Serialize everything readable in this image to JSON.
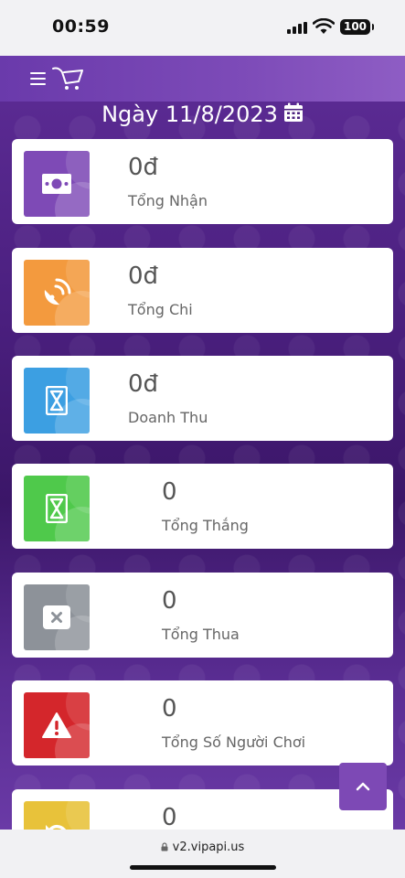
{
  "status_bar": {
    "time": "00:59",
    "battery": "100"
  },
  "header": {
    "menu_icon": "hamburger-icon",
    "logo_icon": "cart-icon"
  },
  "date_title": {
    "text": "Ngày 11/8/2023",
    "icon": "calendar-icon"
  },
  "stats": [
    {
      "value": "0đ",
      "label": "Tổng Nhận",
      "icon": "money-icon",
      "color": "#7e4ab6"
    },
    {
      "value": "0đ",
      "label": "Tổng Chi",
      "icon": "satellite-dish-icon",
      "color": "#f39a3e"
    },
    {
      "value": "0đ",
      "label": "Doanh Thu",
      "icon": "hourglass-icon",
      "color": "#3c9fe2"
    },
    {
      "value": "0",
      "label": "Tổng Thắng",
      "icon": "hourglass-icon",
      "color": "#4fc94b"
    },
    {
      "value": "0",
      "label": "Tổng Thua",
      "icon": "close-box-icon",
      "color": "#8d9299"
    },
    {
      "value": "0",
      "label": "Tổng Số Người Chơi",
      "icon": "warning-icon",
      "color": "#d4262b"
    },
    {
      "value": "0",
      "label": "",
      "icon": "undo-icon",
      "color": "#e8c23a"
    }
  ],
  "scroll_top": {
    "icon": "chevron-up-icon"
  },
  "browser": {
    "url": "v2.vipapi.us"
  }
}
